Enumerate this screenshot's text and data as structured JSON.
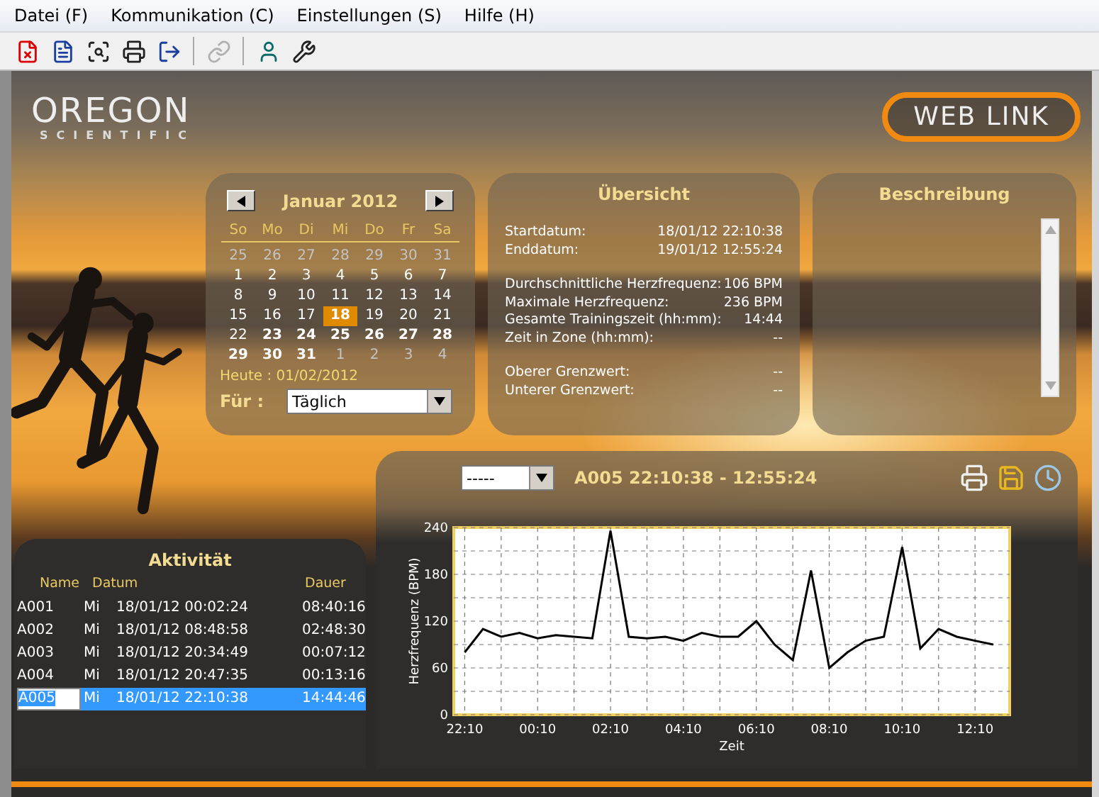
{
  "menu": [
    "Datei (F)",
    "Kommunikation (C)",
    "Einstellungen (S)",
    "Hilfe (H)"
  ],
  "toolbar": [
    {
      "kind": "delete",
      "disabled": false
    },
    {
      "kind": "report",
      "disabled": false
    },
    {
      "kind": "preview",
      "disabled": false
    },
    {
      "kind": "print",
      "disabled": false
    },
    {
      "kind": "exit",
      "disabled": false,
      "separator_after": true
    },
    {
      "kind": "link",
      "disabled": true,
      "separator_after": true
    },
    {
      "kind": "user",
      "disabled": false
    },
    {
      "kind": "tools",
      "disabled": false
    }
  ],
  "logo": {
    "name": "OREGON",
    "tagline": "SCIENTIFIC"
  },
  "web_link": "WEB LINK",
  "calendar": {
    "title": "Januar 2012",
    "weekdays": [
      "So",
      "Mo",
      "Di",
      "Mi",
      "Do",
      "Fr",
      "Sa"
    ],
    "days": [
      {
        "label": "25",
        "in_month": false,
        "has_data": false,
        "selected": false
      },
      {
        "label": "26",
        "in_month": false,
        "has_data": false,
        "selected": false
      },
      {
        "label": "27",
        "in_month": false,
        "has_data": false,
        "selected": false
      },
      {
        "label": "28",
        "in_month": false,
        "has_data": false,
        "selected": false
      },
      {
        "label": "29",
        "in_month": false,
        "has_data": false,
        "selected": false
      },
      {
        "label": "30",
        "in_month": false,
        "has_data": false,
        "selected": false
      },
      {
        "label": "31",
        "in_month": false,
        "has_data": false,
        "selected": false
      },
      {
        "label": "1",
        "in_month": true,
        "has_data": false,
        "selected": false
      },
      {
        "label": "2",
        "in_month": true,
        "has_data": false,
        "selected": false
      },
      {
        "label": "3",
        "in_month": true,
        "has_data": false,
        "selected": false
      },
      {
        "label": "4",
        "in_month": true,
        "has_data": false,
        "selected": false
      },
      {
        "label": "5",
        "in_month": true,
        "has_data": false,
        "selected": false
      },
      {
        "label": "6",
        "in_month": true,
        "has_data": false,
        "selected": false
      },
      {
        "label": "7",
        "in_month": true,
        "has_data": false,
        "selected": false
      },
      {
        "label": "8",
        "in_month": true,
        "has_data": false,
        "selected": false
      },
      {
        "label": "9",
        "in_month": true,
        "has_data": false,
        "selected": false
      },
      {
        "label": "10",
        "in_month": true,
        "has_data": false,
        "selected": false
      },
      {
        "label": "11",
        "in_month": true,
        "has_data": false,
        "selected": false
      },
      {
        "label": "12",
        "in_month": true,
        "has_data": false,
        "selected": false
      },
      {
        "label": "13",
        "in_month": true,
        "has_data": false,
        "selected": false
      },
      {
        "label": "14",
        "in_month": true,
        "has_data": false,
        "selected": false
      },
      {
        "label": "15",
        "in_month": true,
        "has_data": false,
        "selected": false
      },
      {
        "label": "16",
        "in_month": true,
        "has_data": false,
        "selected": false
      },
      {
        "label": "17",
        "in_month": true,
        "has_data": false,
        "selected": false
      },
      {
        "label": "18",
        "in_month": true,
        "has_data": true,
        "selected": true
      },
      {
        "label": "19",
        "in_month": true,
        "has_data": false,
        "selected": false
      },
      {
        "label": "20",
        "in_month": true,
        "has_data": false,
        "selected": false
      },
      {
        "label": "21",
        "in_month": true,
        "has_data": false,
        "selected": false
      },
      {
        "label": "22",
        "in_month": true,
        "has_data": false,
        "selected": false
      },
      {
        "label": "23",
        "in_month": true,
        "has_data": true,
        "selected": false
      },
      {
        "label": "24",
        "in_month": true,
        "has_data": true,
        "selected": false
      },
      {
        "label": "25",
        "in_month": true,
        "has_data": true,
        "selected": false
      },
      {
        "label": "26",
        "in_month": true,
        "has_data": true,
        "selected": false
      },
      {
        "label": "27",
        "in_month": true,
        "has_data": true,
        "selected": false
      },
      {
        "label": "28",
        "in_month": true,
        "has_data": true,
        "selected": false
      },
      {
        "label": "29",
        "in_month": true,
        "has_data": true,
        "selected": false
      },
      {
        "label": "30",
        "in_month": true,
        "has_data": true,
        "selected": false
      },
      {
        "label": "31",
        "in_month": true,
        "has_data": true,
        "selected": false
      },
      {
        "label": "1",
        "in_month": false,
        "has_data": false,
        "selected": false
      },
      {
        "label": "2",
        "in_month": false,
        "has_data": false,
        "selected": false
      },
      {
        "label": "3",
        "in_month": false,
        "has_data": false,
        "selected": false
      },
      {
        "label": "4",
        "in_month": false,
        "has_data": false,
        "selected": false
      }
    ],
    "today": "Heute : 01/02/2012",
    "for_label": "Für :",
    "for_value": "Täglich"
  },
  "overview": {
    "title": "Übersicht",
    "groups": [
      [
        {
          "label": "Startdatum:",
          "value": "18/01/12 22:10:38"
        },
        {
          "label": "Enddatum:",
          "value": "19/01/12 12:55:24"
        }
      ],
      [
        {
          "label": "Durchschnittliche Herzfrequenz:",
          "value": "106 BPM"
        },
        {
          "label": "Maximale Herzfrequenz:",
          "value": "236 BPM"
        },
        {
          "label": "Gesamte Trainingszeit (hh:mm):",
          "value": "14:44"
        },
        {
          "label": "Zeit in Zone (hh:mm):",
          "value": "--"
        }
      ],
      [
        {
          "label": "Oberer Grenzwert:",
          "value": "--"
        },
        {
          "label": "Unterer Grenzwert:",
          "value": "--"
        }
      ]
    ]
  },
  "description": {
    "title": "Beschreibung"
  },
  "activity": {
    "title": "Aktivität",
    "columns": [
      "Name",
      "Datum",
      "Dauer"
    ],
    "rows": [
      {
        "name": "A001",
        "day": "Mi",
        "date": "18/01/12 00:02:24",
        "duration": "08:40:16",
        "selected": false
      },
      {
        "name": "A002",
        "day": "Mi",
        "date": "18/01/12 08:48:58",
        "duration": "02:48:30",
        "selected": false
      },
      {
        "name": "A003",
        "day": "Mi",
        "date": "18/01/12 20:34:49",
        "duration": "00:07:12",
        "selected": false
      },
      {
        "name": "A004",
        "day": "Mi",
        "date": "18/01/12 20:47:35",
        "duration": "00:13:16",
        "selected": false
      },
      {
        "name": "A005",
        "day": "Mi",
        "date": "18/01/12 22:10:38",
        "duration": "14:44:46",
        "selected": true
      }
    ]
  },
  "graph": {
    "selector": "-----",
    "title": "A005 22:10:38 - 12:55:24",
    "chart_data": {
      "type": "line",
      "xlabel": "Zeit",
      "ylabel": "Herzfrequenz (BPM)",
      "categories": [
        "22:10",
        null,
        null,
        null,
        "00:10",
        null,
        null,
        null,
        "02:10",
        null,
        null,
        null,
        "04:10",
        null,
        null,
        null,
        "06:10",
        null,
        null,
        null,
        "08:10",
        null,
        null,
        null,
        "10:10",
        null,
        null,
        null,
        "12:10",
        null
      ],
      "series": [
        {
          "color": "#000000",
          "values": [
            80,
            110,
            100,
            105,
            98,
            102,
            100,
            98,
            236,
            100,
            98,
            100,
            95,
            105,
            100,
            100,
            120,
            90,
            70,
            185,
            60,
            80,
            95,
            100,
            215,
            85,
            110,
            100,
            95,
            90
          ]
        }
      ],
      "ylim": [
        0,
        240
      ],
      "yticks": [
        0,
        60,
        120,
        180,
        240
      ],
      "grid": true
    }
  }
}
